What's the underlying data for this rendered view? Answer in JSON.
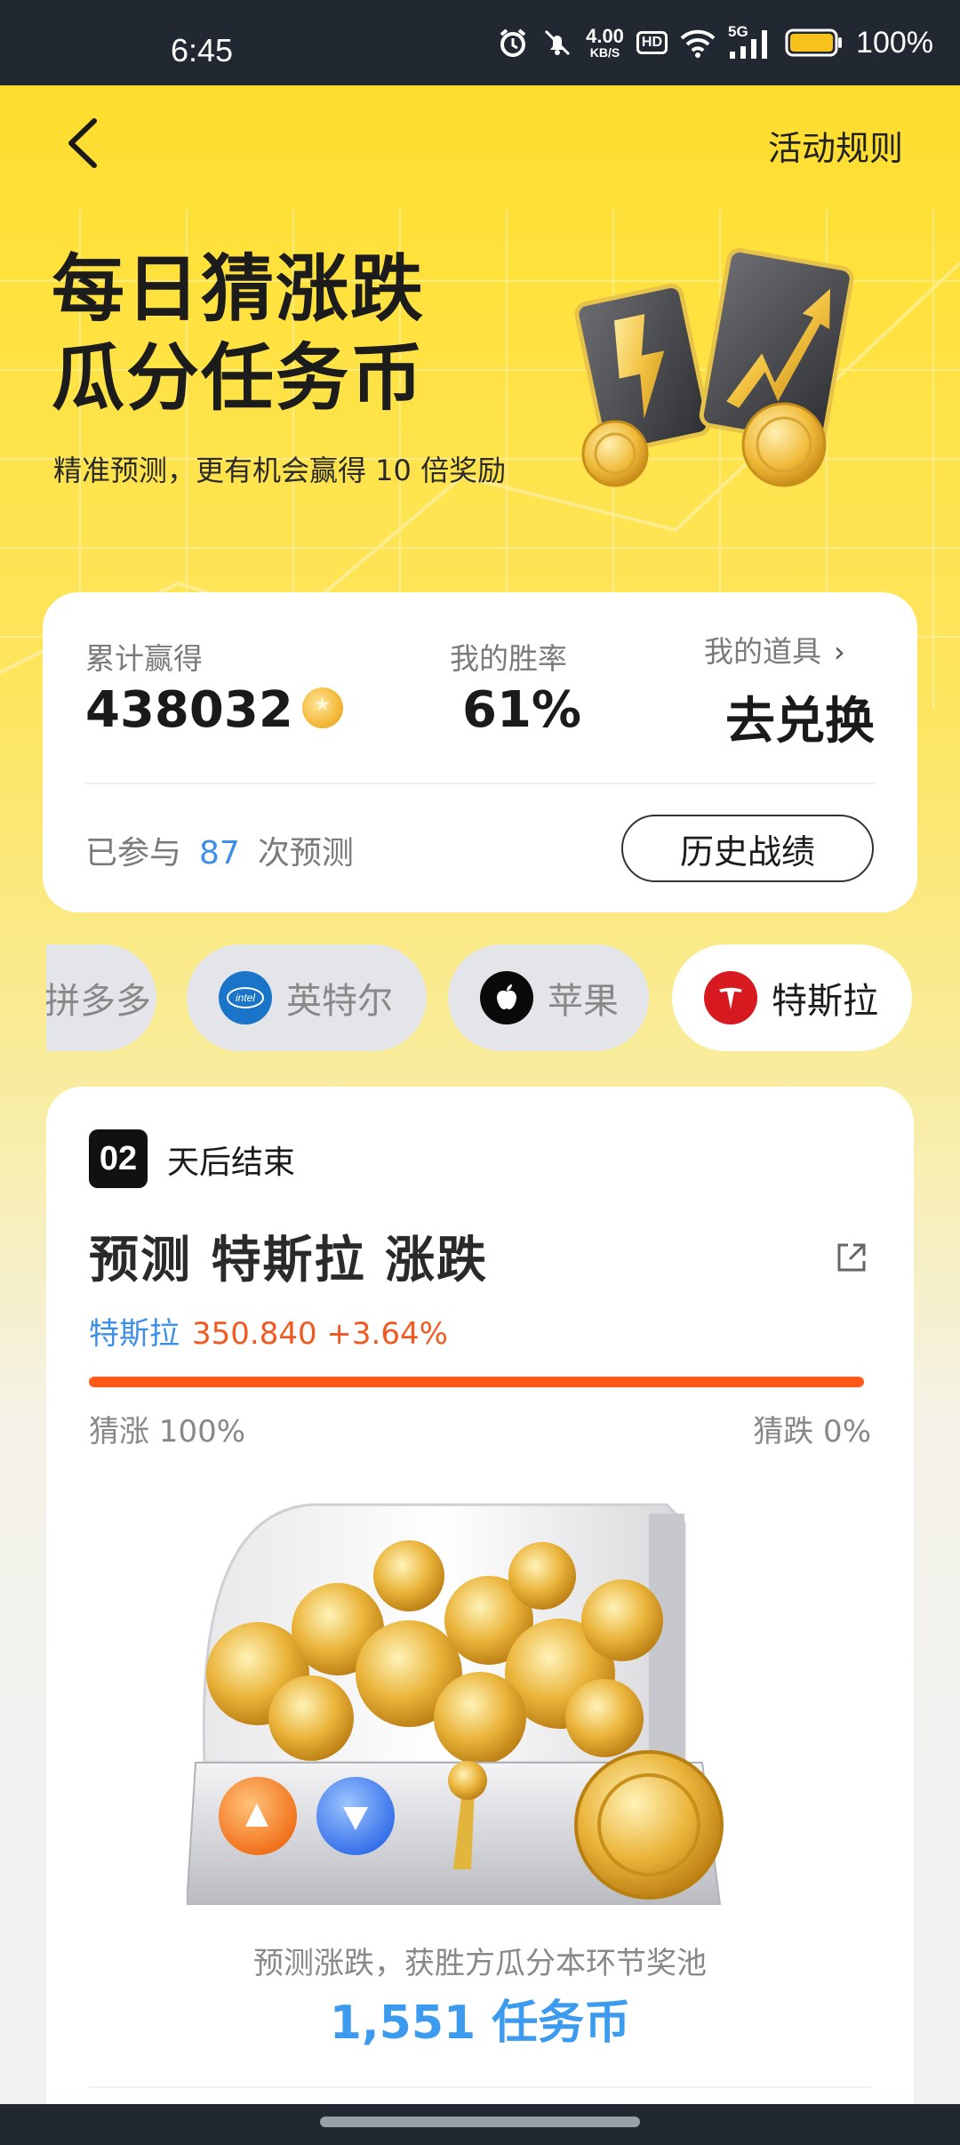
{
  "status_bar": {
    "time": "6:45",
    "net_speed_value": "4.00",
    "net_speed_unit": "KB/S",
    "hd": "HD",
    "network": "5G",
    "battery": "100%"
  },
  "nav": {
    "rules_label": "活动规则"
  },
  "hero": {
    "title_line1": "每日猜涨跌",
    "title_line2": "瓜分任务币",
    "subtitle": "精准预测，更有机会赢得 10 倍奖励"
  },
  "stats": {
    "earned_label": "累计赢得",
    "earned_value": "438032",
    "winrate_label": "我的胜率",
    "winrate_value": "61%",
    "props_label": "我的道具",
    "exchange_label": "去兑换",
    "participated_prefix": "已参与",
    "participated_count": "87",
    "participated_suffix": "次预测",
    "history_button": "历史战绩"
  },
  "stocks": [
    {
      "label": "拼多多",
      "logo": "pinduoduo-logo",
      "active": false
    },
    {
      "label": "英特尔",
      "logo": "intel-logo",
      "active": false
    },
    {
      "label": "苹果",
      "logo": "apple-logo",
      "active": false
    },
    {
      "label": "特斯拉",
      "logo": "tesla-logo",
      "active": true
    }
  ],
  "prediction": {
    "days_left": "02",
    "days_suffix": "天后结束",
    "title": "预测 特斯拉 涨跌",
    "stock_name": "特斯拉",
    "price_change": "350.840 +3.64%",
    "up_fraction": 1.0,
    "guess_up": "猜涨 100%",
    "guess_down": "猜跌 0%",
    "pool_desc": "预测涨跌，获胜方瓜分本环节奖池",
    "pool_amount": "1,551 任务币"
  },
  "colors": {
    "brand_yellow": "#ffdd2e",
    "price_orange": "#f05a22",
    "link_blue": "#3d8ee8"
  }
}
